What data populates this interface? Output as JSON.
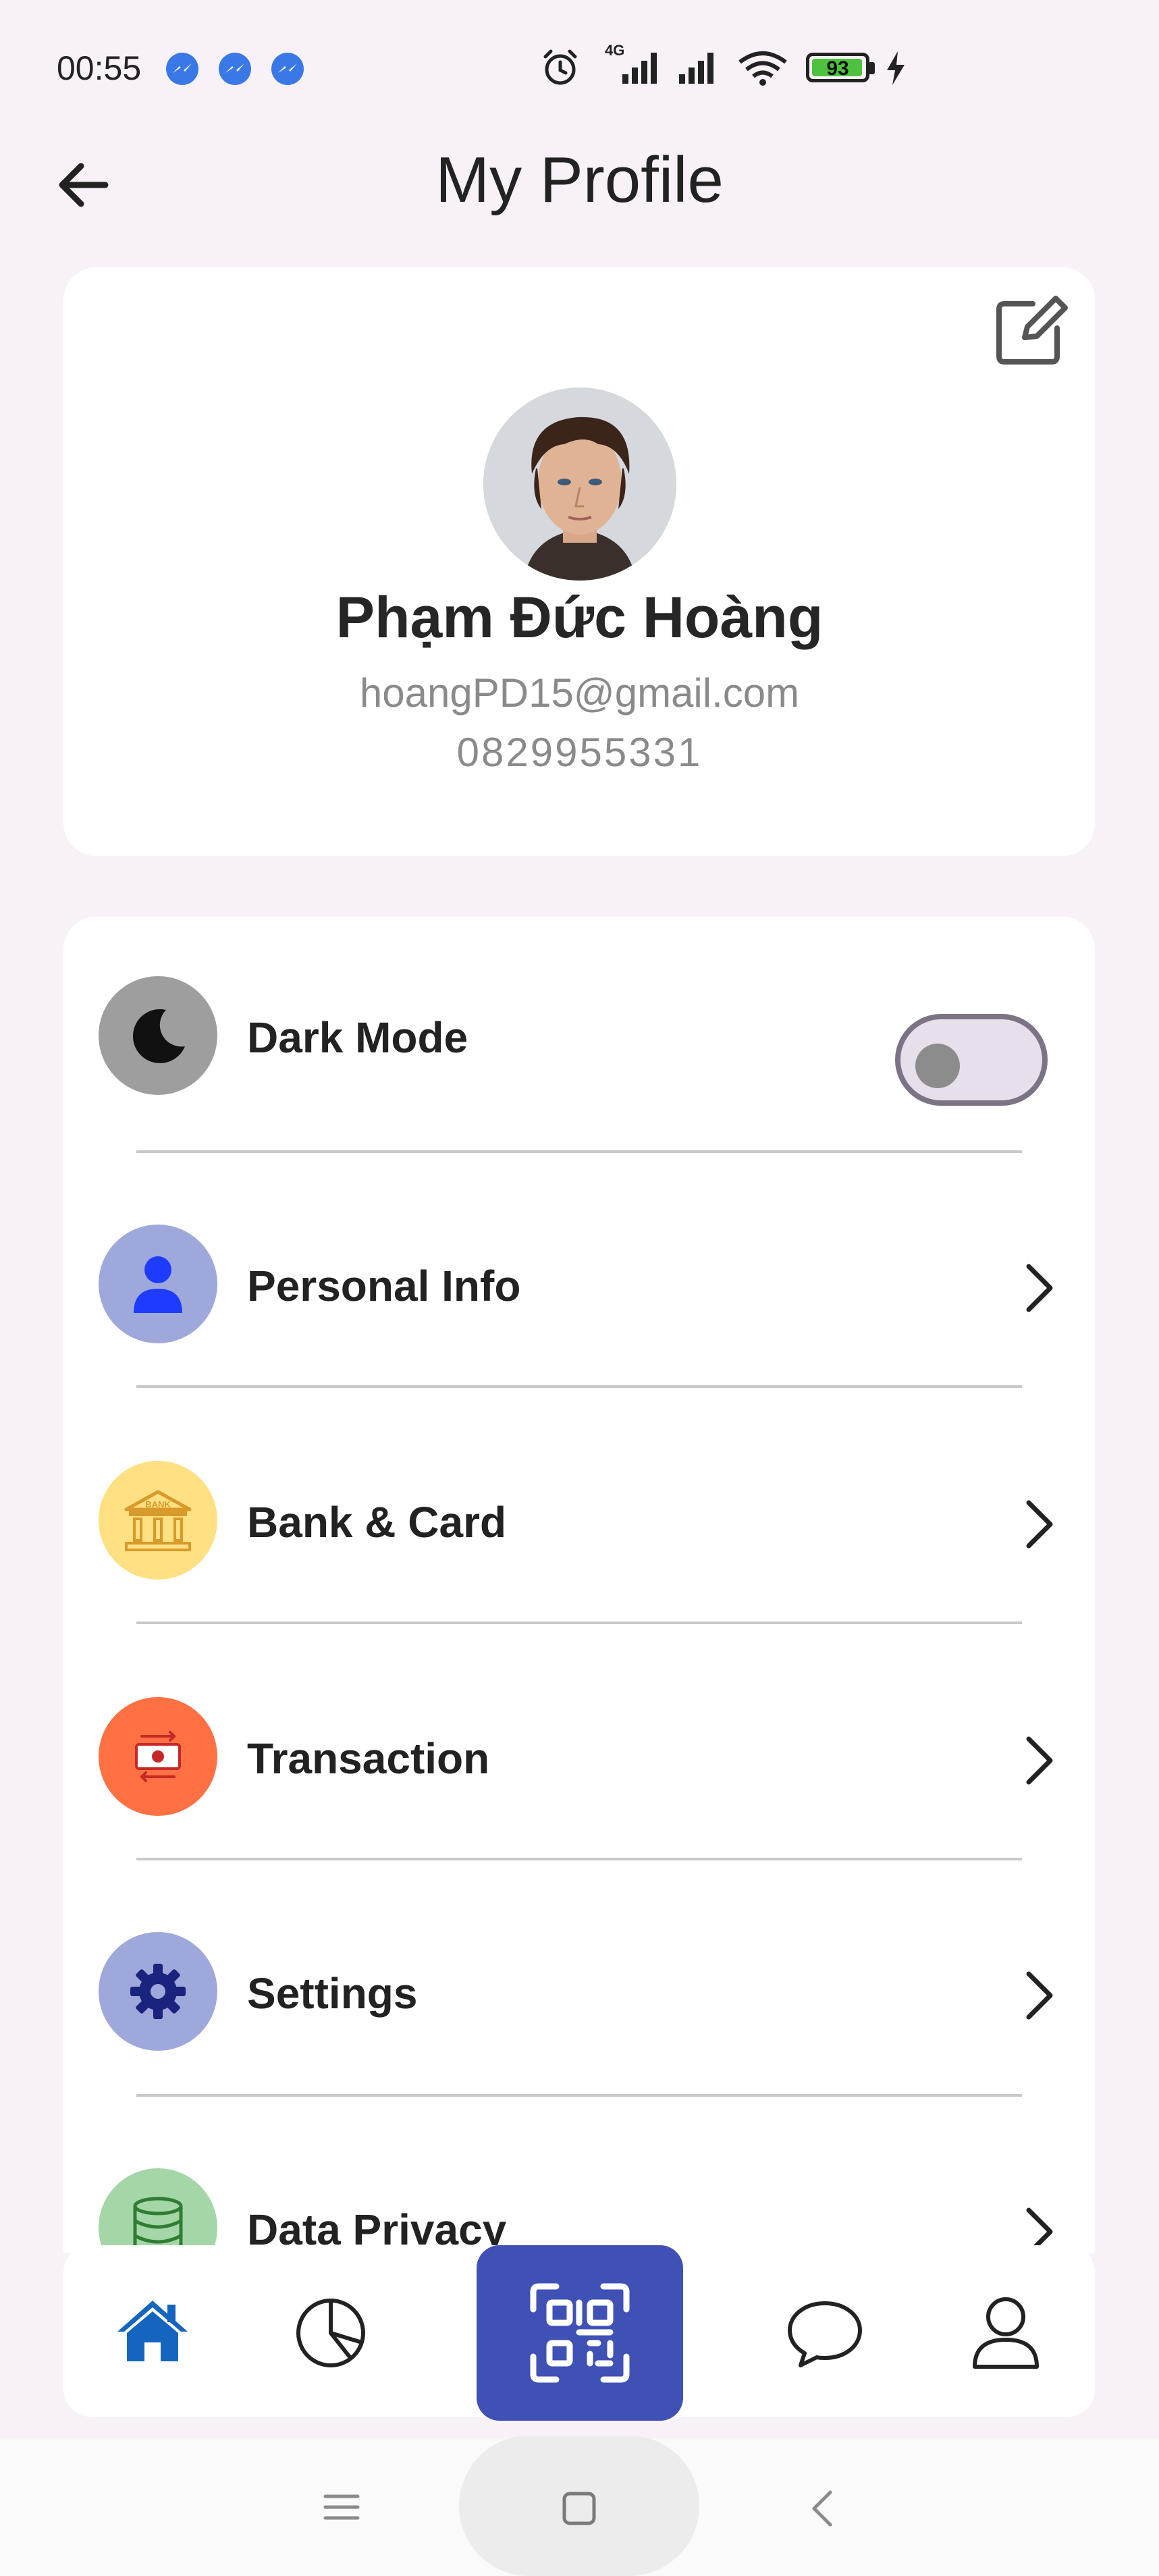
{
  "status_bar": {
    "time": "00:55",
    "network": "4G",
    "battery": "93",
    "icons": [
      "messenger-icon",
      "messenger-icon",
      "messenger-icon",
      "alarm-icon",
      "signal-icon",
      "signal-icon",
      "wifi-icon",
      "battery-icon",
      "charging-icon"
    ]
  },
  "header": {
    "title": "My Profile",
    "back_icon": "arrow-left-icon"
  },
  "profile": {
    "name": "Phạm Đức Hoàng",
    "email": "hoangPD15@gmail.com",
    "phone": "0829955331",
    "edit_icon": "edit-icon"
  },
  "menu": {
    "dark_mode": {
      "label": "Dark Mode",
      "enabled": false,
      "icon": "moon-icon",
      "icon_bg": "#9e9e9e"
    },
    "items": [
      {
        "label": "Personal Info",
        "icon": "person-icon",
        "icon_bg": "#9fa8da"
      },
      {
        "label": "Bank & Card",
        "icon": "bank-icon",
        "icon_bg": "#ffe082"
      },
      {
        "label": "Transaction",
        "icon": "transaction-icon",
        "icon_bg": "#ff7043"
      },
      {
        "label": "Settings",
        "icon": "gear-icon",
        "icon_bg": "#9fa8da"
      },
      {
        "label": "Data Privacy",
        "icon": "database-icon",
        "icon_bg": "#a5d6a7"
      }
    ],
    "bank_icon_text": "BANK"
  },
  "bottom_nav": {
    "items": [
      "home-icon",
      "pie-chart-icon",
      "qr-code-icon",
      "chat-icon",
      "user-icon"
    ],
    "accent": "#3f51b5",
    "active_color": "#1565c0"
  },
  "system_nav": [
    "menu-icon",
    "home-square-icon",
    "back-chevron-icon"
  ]
}
